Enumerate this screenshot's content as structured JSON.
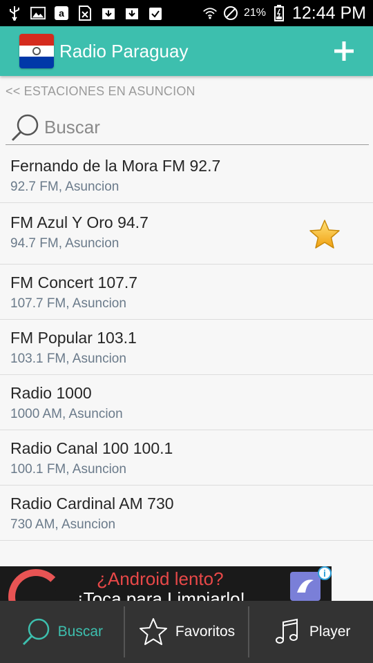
{
  "statusbar": {
    "battery_pct": "21%",
    "time": "12:44 PM"
  },
  "app": {
    "title": "Radio Paraguay",
    "accent": "#3dbfae"
  },
  "breadcrumb": "<< ESTACIONES EN ASUNCION",
  "search": {
    "placeholder": "Buscar",
    "value": ""
  },
  "stations": [
    {
      "name": "Fernando de la Mora FM 92.7",
      "sub": "92.7 FM, Asuncion",
      "favorite": false
    },
    {
      "name": "FM Azul Y Oro 94.7",
      "sub": "94.7 FM, Asuncion",
      "favorite": true
    },
    {
      "name": "FM Concert 107.7",
      "sub": "107.7 FM, Asuncion",
      "favorite": false
    },
    {
      "name": "FM Popular 103.1",
      "sub": "103.1 FM, Asuncion",
      "favorite": false
    },
    {
      "name": "Radio 1000",
      "sub": "1000 AM, Asuncion",
      "favorite": false
    },
    {
      "name": "Radio Canal 100 100.1",
      "sub": "100.1 FM, Asuncion",
      "favorite": false
    },
    {
      "name": "Radio Cardinal AM 730",
      "sub": "730 AM, Asuncion",
      "favorite": false
    }
  ],
  "ad": {
    "line1": "¿Android lento?",
    "line2": "¡Toca para Limpiarlo!"
  },
  "bottomnav": {
    "items": [
      {
        "label": "Buscar",
        "icon": "search-icon",
        "active": true
      },
      {
        "label": "Favoritos",
        "icon": "star-outline-icon",
        "active": false
      },
      {
        "label": "Player",
        "icon": "music-note-icon",
        "active": false
      }
    ]
  }
}
